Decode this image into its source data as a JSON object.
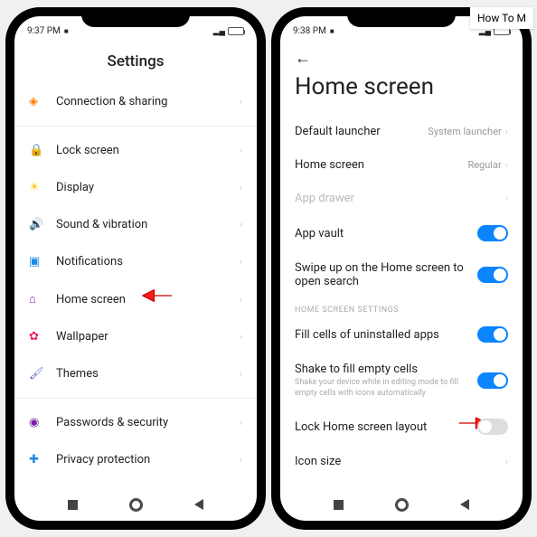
{
  "howto_label": "How To M",
  "phone1": {
    "status": {
      "time": "9:37 PM",
      "cam": "■"
    },
    "title": "Settings",
    "items": [
      {
        "icon": "◈",
        "icon_cls": "ic-orange",
        "label": "Connection & sharing"
      },
      {
        "divider": true
      },
      {
        "icon": "🔒",
        "icon_cls": "ic-red",
        "label": "Lock screen"
      },
      {
        "icon": "☀",
        "icon_cls": "ic-yellow",
        "label": "Display"
      },
      {
        "icon": "🔊",
        "icon_cls": "ic-green",
        "label": "Sound & vibration"
      },
      {
        "icon": "▣",
        "icon_cls": "ic-blue",
        "label": "Notifications"
      },
      {
        "icon": "⌂",
        "icon_cls": "ic-purple",
        "label": "Home screen",
        "callout": true
      },
      {
        "icon": "✿",
        "icon_cls": "ic-pink",
        "label": "Wallpaper"
      },
      {
        "icon": "🖌",
        "icon_cls": "ic-cyan",
        "label": "Themes"
      },
      {
        "divider": true
      },
      {
        "icon": "◉",
        "icon_cls": "ic-purple",
        "label": "Passwords & security"
      },
      {
        "icon": "✚",
        "icon_cls": "ic-blue",
        "label": "Privacy protection"
      }
    ]
  },
  "phone2": {
    "status": {
      "time": "9:38 PM",
      "cam": "■"
    },
    "title": "Home screen",
    "rows": [
      {
        "type": "value",
        "label": "Default launcher",
        "value": "System launcher"
      },
      {
        "type": "value",
        "label": "Home screen",
        "value": "Regular"
      },
      {
        "type": "disabled",
        "label": "App drawer"
      },
      {
        "type": "toggle",
        "label": "App vault",
        "on": true
      },
      {
        "type": "toggle",
        "label": "Swipe up on the Home screen to open search",
        "on": true
      },
      {
        "type": "section",
        "label": "HOME SCREEN SETTINGS"
      },
      {
        "type": "toggle",
        "label": "Fill cells of uninstalled apps",
        "on": true
      },
      {
        "type": "toggle",
        "label": "Shake to fill empty cells",
        "sub": "Shake your device while in editing mode to fill empty cells with icons automatically",
        "on": true
      },
      {
        "type": "toggle",
        "label": "Lock Home screen layout",
        "on": false,
        "callout": true
      },
      {
        "type": "value",
        "label": "Icon size",
        "value": ""
      }
    ]
  }
}
